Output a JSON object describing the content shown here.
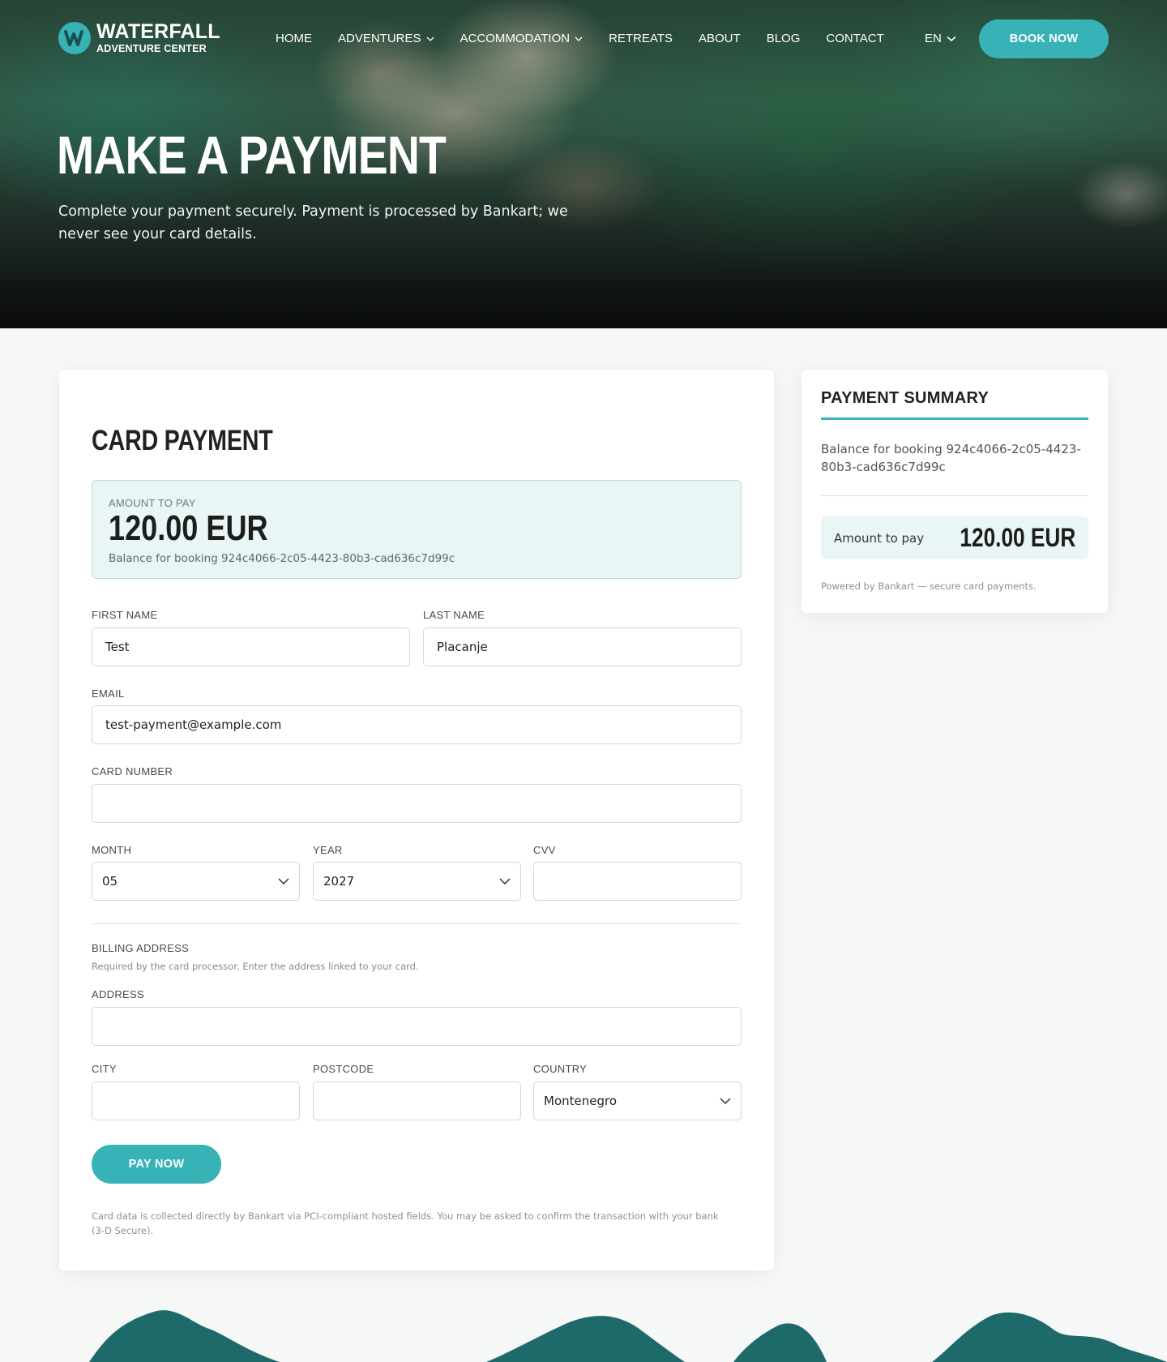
{
  "nav": {
    "logo_title": "WATERFALL",
    "logo_sub": "ADVENTURE CENTER",
    "links": [
      {
        "label": "HOME",
        "has_menu": false
      },
      {
        "label": "ADVENTURES",
        "has_menu": true
      },
      {
        "label": "ACCOMMODATION",
        "has_menu": true
      },
      {
        "label": "RETREATS",
        "has_menu": false
      },
      {
        "label": "ABOUT",
        "has_menu": false
      },
      {
        "label": "BLOG",
        "has_menu": false
      },
      {
        "label": "CONTACT",
        "has_menu": false
      }
    ],
    "language": "EN",
    "book_label": "BOOK NOW"
  },
  "hero": {
    "title": "MAKE A PAYMENT",
    "subtitle": "Complete your payment securely. Payment is processed by Bankart; we never see your card details."
  },
  "card": {
    "title": "CARD PAYMENT",
    "amount_label": "AMOUNT TO PAY",
    "amount_value": "120.00 EUR",
    "amount_note": "Balance for booking 924c4066-2c05-4423-80b3-cad636c7d99c",
    "first_name_label": "FIRST NAME",
    "first_name_value": "Test",
    "last_name_label": "LAST NAME",
    "last_name_value": "Placanje",
    "email_label": "EMAIL",
    "email_value": "test-payment@example.com",
    "card_number_label": "CARD NUMBER",
    "card_number_value": "",
    "month_label": "MONTH",
    "month_value": "05",
    "year_label": "YEAR",
    "year_value": "2027",
    "cvv_label": "CVV",
    "cvv_value": "",
    "billing_title": "BILLING ADDRESS",
    "billing_note": "Required by the card processor. Enter the address linked to your card.",
    "address_label": "ADDRESS",
    "address_value": "",
    "city_label": "CITY",
    "city_value": "",
    "postcode_label": "POSTCODE",
    "postcode_value": "",
    "country_label": "COUNTRY",
    "country_value": "Montenegro",
    "pay_label": "PAY NOW",
    "footnote": "Card data is collected directly by Bankart via PCI-compliant hosted fields. You may be asked to confirm the transaction with your bank (3-D Secure)."
  },
  "summary": {
    "title": "PAYMENT SUMMARY",
    "description": "Balance for booking 924c4066-2c05-4423-80b3-cad636c7d99c",
    "amount_label": "Amount to pay",
    "amount_value": "120.00 EUR",
    "powered": "Powered by Bankart — secure card payments."
  },
  "colors": {
    "accent": "#37b2b7",
    "amount_bg": "#e9f6f5",
    "mountain": "#1e6a6a"
  },
  "icons": {
    "logo": "waterfall-logo-icon",
    "dropdown": "chevron-down-icon"
  }
}
